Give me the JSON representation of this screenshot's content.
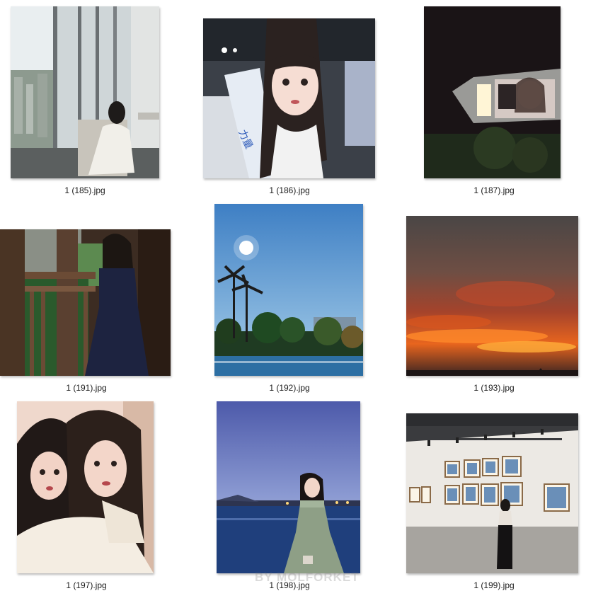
{
  "files": [
    {
      "name": "1 (185).jpg",
      "subject": "woman-by-window"
    },
    {
      "name": "1 (186).jpg",
      "subject": "concert-selfie"
    },
    {
      "name": "1 (187).jpg",
      "subject": "car-mirror-selfie"
    },
    {
      "name": "1 (191).jpg",
      "subject": "woman-on-balcony"
    },
    {
      "name": "1 (192).jpg",
      "subject": "palm-trees-pool"
    },
    {
      "name": "1 (193).jpg",
      "subject": "sunset-clouds"
    },
    {
      "name": "1 (197).jpg",
      "subject": "two-girls-selfie"
    },
    {
      "name": "1 (198).jpg",
      "subject": "woman-at-dusk-sea"
    },
    {
      "name": "1 (199).jpg",
      "subject": "gallery-visitor"
    }
  ],
  "watermark": "BY MOLFORKET",
  "colors": {
    "caption_text": "#1a1a1a",
    "background": "#ffffff"
  }
}
